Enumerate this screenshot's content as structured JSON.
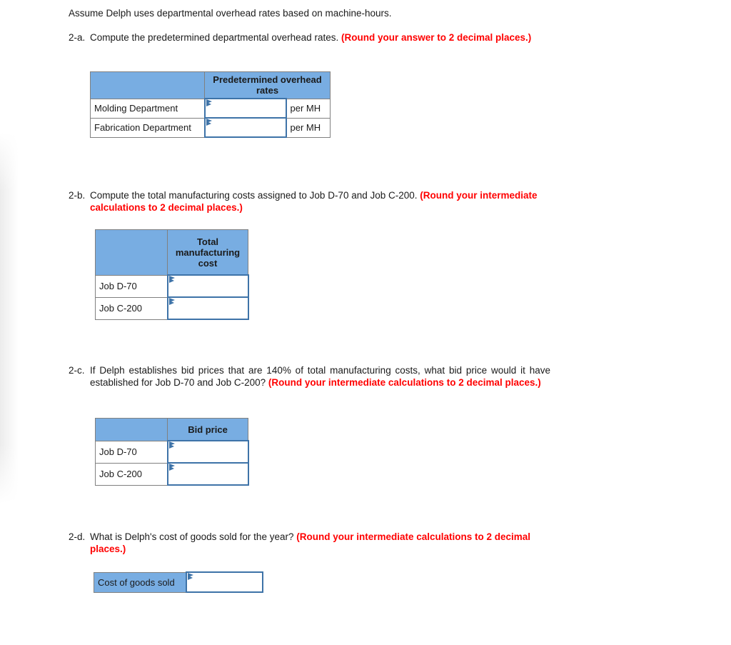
{
  "intro": {
    "text": "Assume Delph uses departmental overhead rates based on machine-hours."
  },
  "questions": [
    {
      "number": "2-a.",
      "text": "Compute the predetermined departmental overhead rates. ",
      "note": "(Round your answer to 2 decimal places.)"
    },
    {
      "number": "2-b.",
      "text": "Compute the total manufacturing costs assigned to Job D-70 and Job C-200. ",
      "note": "(Round your intermediate calculations to 2 decimal places.)"
    },
    {
      "number": "2-c.",
      "text": "If Delph establishes bid prices that are 140% of total manufacturing costs, what bid price would it have established for Job D-70 and Job C-200? ",
      "note": "(Round your intermediate calculations to 2 decimal places.)"
    },
    {
      "number": "2-d.",
      "text": "What is Delph's cost of goods sold for the year? ",
      "note": "(Round your intermediate calculations to 2 decimal places.)"
    }
  ],
  "tables": {
    "overhead_rates": {
      "header_blank": "",
      "header_label": "Predetermined overhead rates",
      "rows": [
        {
          "label": "Molding Department",
          "value": "",
          "unit": "per MH"
        },
        {
          "label": "Fabrication Department",
          "value": "",
          "unit": "per MH"
        }
      ]
    },
    "total_manufacturing_cost": {
      "header_blank": "",
      "header_label": "Total manufacturing cost",
      "rows": [
        {
          "label": "Job D-70",
          "value": ""
        },
        {
          "label": "Job C-200",
          "value": ""
        }
      ]
    },
    "bid_price": {
      "header_blank": "",
      "header_label": "Bid price",
      "rows": [
        {
          "label": "Job D-70",
          "value": ""
        },
        {
          "label": "Job C-200",
          "value": ""
        }
      ]
    },
    "cost_of_goods_sold": {
      "label": "Cost of goods sold",
      "value": ""
    }
  },
  "colors": {
    "header_blue": "#78ADE2",
    "input_border_blue": "#3E73A8",
    "note_red": "#FF0000",
    "cell_border_gray": "#808080"
  }
}
